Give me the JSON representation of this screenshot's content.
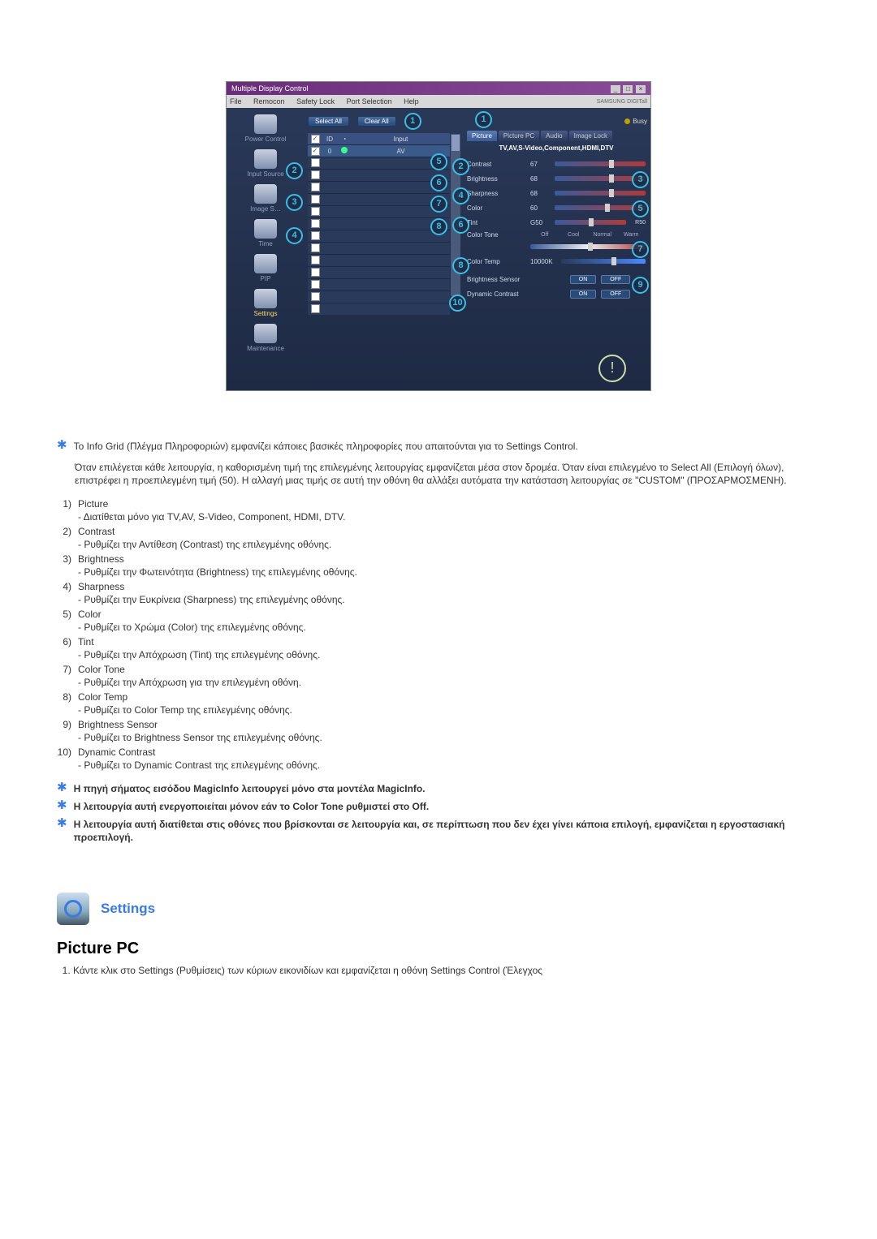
{
  "screenshot": {
    "titlebar": "Multiple Display Control",
    "menu": {
      "file": "File",
      "remocon": "Remocon",
      "safety": "Safety Lock",
      "port": "Port Selection",
      "help": "Help",
      "brand": "SAMSUNG DIGITall"
    },
    "sidebar": {
      "power": "Power Control",
      "input": "Input Source",
      "image": "Image S…",
      "time": "Time",
      "pip": "PIP",
      "settings": "Settings",
      "maint": "Maintenance"
    },
    "buttons": {
      "selectall": "Select All",
      "clearall": "Clear All",
      "busy": "Busy"
    },
    "grid": {
      "h_id": "ID",
      "h_input": "Input",
      "r1_id": "0",
      "r1_input": "AV"
    },
    "tabs": {
      "picture": "Picture",
      "picturepc": "Picture PC",
      "audio": "Audio",
      "imagelock": "Image Lock"
    },
    "subtitle": "TV,AV,S-Video,Component,HDMI,DTV",
    "rows": {
      "contrast": "Contrast",
      "contrast_v": "67",
      "brightness": "Brightness",
      "brightness_v": "68",
      "sharpness": "Sharpness",
      "sharpness_v": "68",
      "color": "Color",
      "color_v": "60",
      "tint": "Tint",
      "tint_v": "G50",
      "tint_r": "R50",
      "tone": "Color Tone",
      "tone_off": "Off",
      "tone_cool": "Cool",
      "tone_normal": "Normal",
      "tone_warm": "Warm",
      "temp": "Color Temp",
      "temp_v": "10000K",
      "bsensor": "Brightness Sensor",
      "dyn": "Dynamic Contrast",
      "on": "ON",
      "off": "OFF"
    }
  },
  "callouts": {
    "c1": "1",
    "c2": "2",
    "c3": "3",
    "c4": "4",
    "c5": "5",
    "c6": "6",
    "c7": "7",
    "c8": "8",
    "c9": "9",
    "c10": "10",
    "s2": "2",
    "s3": "3",
    "s4": "4",
    "s5": "5",
    "s6": "6",
    "s7": "7",
    "s8": "8"
  },
  "text": {
    "star1": "Το Info Grid (Πλέγμα Πληροφοριών) εμφανίζει κάποιες βασικές πληροφορίες που απαιτούνται για το Settings Control.",
    "para1": "Όταν επιλέγεται κάθε λειτουργία, η καθορισμένη τιμή της επιλεγμένης λειτουργίας εμφανίζεται μέσα στον δρομέα. Όταν είναι επιλεγμένο το Select All (Επιλογή όλων), επιστρέφει η προεπιλεγμένη τιμή (50). Η αλλαγή μιας τιμής σε αυτή την οθόνη θα αλλάξει αυτόματα την κατάσταση λειτουργίας σε \"CUSTOM\" (ΠΡΟΣΑΡΜΟΣΜΕΝΗ).",
    "i1t": "Picture",
    "i1d": "- Διατίθεται μόνο για TV,AV, S-Video, Component, HDMI, DTV.",
    "i2t": "Contrast",
    "i2d": "- Ρυθμίζει την Αντίθεση (Contrast) της επιλεγμένης οθόνης.",
    "i3t": "Brightness",
    "i3d": "- Ρυθμίζει την Φωτεινότητα (Brightness) της επιλεγμένης οθόνης.",
    "i4t": "Sharpness",
    "i4d": "- Ρυθμίζει την Ευκρίνεια (Sharpness) της επιλεγμένης οθόνης.",
    "i5t": "Color",
    "i5d": "- Ρυθμίζει το Χρώμα (Color) της επιλεγμένης οθόνης.",
    "i6t": "Tint",
    "i6d": "- Ρυθμίζει την Απόχρωση (Tint) της επιλεγμένης οθόνης.",
    "i7t": "Color Tone",
    "i7d": "- Ρυθμίζει την Απόχρωση για την επιλεγμένη οθόνη.",
    "i8t": "Color Temp",
    "i8d": "- Ρυθμίζει το Color Temp της επιλεγμένης οθόνης.",
    "i9t": "Brightness Sensor",
    "i9d": "- Ρυθμίζει το Brightness Sensor της επιλεγμένης οθόνης.",
    "i10t": "Dynamic Contrast",
    "i10d": "- Ρυθμίζει το Dynamic Contrast της επιλεγμένης οθόνης.",
    "note1": "Η πηγή σήματος εισόδου MagicInfo λειτουργεί μόνο στα μοντέλα MagicInfo.",
    "note2": "Η λειτουργία αυτή ενεργοποιείται μόνον εάν το Color Tone ρυθμιστεί στο Off.",
    "note3": "Η λειτουργία αυτή διατίθεται στις οθόνες που βρίσκονται σε λειτουργία και, σε περίπτωση που δεν έχει γίνει κάποια επιλογή, εμφανίζεται η εργοστασιακή προεπιλογή.",
    "section_title": "Settings",
    "subheading": "Picture PC",
    "step1": "Κάντε κλικ στο Settings (Ρυθμίσεις) των κύριων εικονιδίων και εμφανίζεται η οθόνη Settings Control (Έλεγχος"
  },
  "nums": {
    "n1": "1)",
    "n2": "2)",
    "n3": "3)",
    "n4": "4)",
    "n5": "5)",
    "n6": "6)",
    "n7": "7)",
    "n8": "8)",
    "n9": "9)",
    "n10": "10)"
  }
}
